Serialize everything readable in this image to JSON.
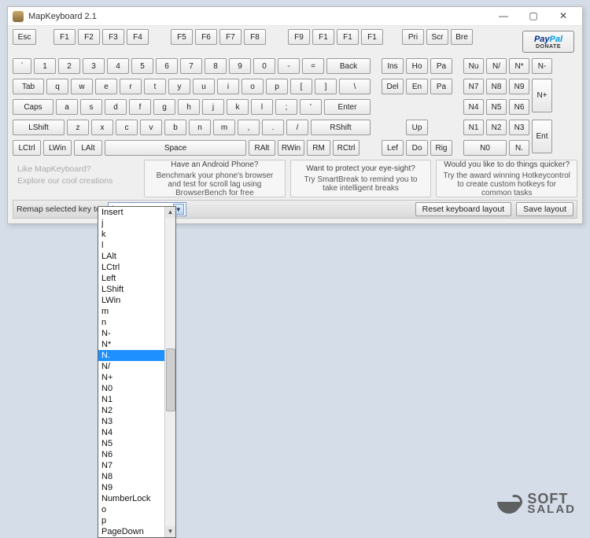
{
  "window": {
    "title": "MapKeyboard 2.1"
  },
  "winctrl": {
    "min": "—",
    "max": "▢",
    "close": "✕"
  },
  "paypal": {
    "brand1": "Pay",
    "brand2": "Pal",
    "sub": "DONATE"
  },
  "fnrow": [
    "Esc",
    "F1",
    "F2",
    "F3",
    "F4",
    "F5",
    "F6",
    "F7",
    "F8",
    "F9",
    "F1",
    "F1",
    "F1",
    "Pri",
    "Scr",
    "Bre"
  ],
  "numrow": [
    "`",
    "1",
    "2",
    "3",
    "4",
    "5",
    "6",
    "7",
    "8",
    "9",
    "0",
    "-",
    "=",
    "Back"
  ],
  "qrow": [
    "Tab",
    "q",
    "w",
    "e",
    "r",
    "t",
    "y",
    "u",
    "i",
    "o",
    "p",
    "[",
    "]",
    "\\"
  ],
  "arow": [
    "Caps",
    "a",
    "s",
    "d",
    "f",
    "g",
    "h",
    "j",
    "k",
    "l",
    ";",
    "'",
    "Enter"
  ],
  "zrow": [
    "LShift",
    "z",
    "x",
    "c",
    "v",
    "b",
    "n",
    "m",
    ",",
    ".",
    "/",
    "RShift"
  ],
  "sprow": [
    "LCtrl",
    "LWin",
    "LAlt",
    "Space",
    "RAlt",
    "RWin",
    "RM",
    "RCtrl"
  ],
  "nav1": [
    "Ins",
    "Ho",
    "Pa"
  ],
  "nav2": [
    "Del",
    "En",
    "Pa"
  ],
  "arrows": {
    "up": "Up",
    "left": "Lef",
    "down": "Do",
    "right": "Rig"
  },
  "numpad": {
    "r1": [
      "Nu",
      "N/",
      "N*",
      "N-"
    ],
    "r2": [
      "N7",
      "N8",
      "N9"
    ],
    "r3": [
      "N4",
      "N5",
      "N6"
    ],
    "r4": [
      "N1",
      "N2",
      "N3"
    ],
    "r5": [
      "N0",
      "N."
    ],
    "plus": "N+",
    "enter": "Ent"
  },
  "promos": {
    "p0a": "Like MapKeyboard?",
    "p0b": "Explore our cool creations",
    "p1h": "Have an Android Phone?",
    "p1b": "Benchmark your phone's browser and test for scroll lag using BrowserBench for free",
    "p2h": "Want to protect your eye-sight?",
    "p2b": "Try SmartBreak to remind you to take intelligent breaks",
    "p3h": "Would you like to do things quicker?",
    "p3b": "Try the award winning Hotkeycontrol to create custom hotkeys for common tasks"
  },
  "remap": {
    "label": "Remap selected key to:",
    "value": "Insert",
    "reset": "Reset keyboard layout",
    "save": "Save layout"
  },
  "dropdown": {
    "selected": "N.",
    "items": [
      "Insert",
      "j",
      "k",
      "l",
      "LAlt",
      "LCtrl",
      "Left",
      "LShift",
      "LWin",
      "m",
      "n",
      "N-",
      "N*",
      "N.",
      "N/",
      "N+",
      "N0",
      "N1",
      "N2",
      "N3",
      "N4",
      "N5",
      "N6",
      "N7",
      "N8",
      "N9",
      "NumberLock",
      "o",
      "p",
      "PageDown"
    ]
  },
  "brand": {
    "l1": "SOFT",
    "l2": "SALAD"
  }
}
